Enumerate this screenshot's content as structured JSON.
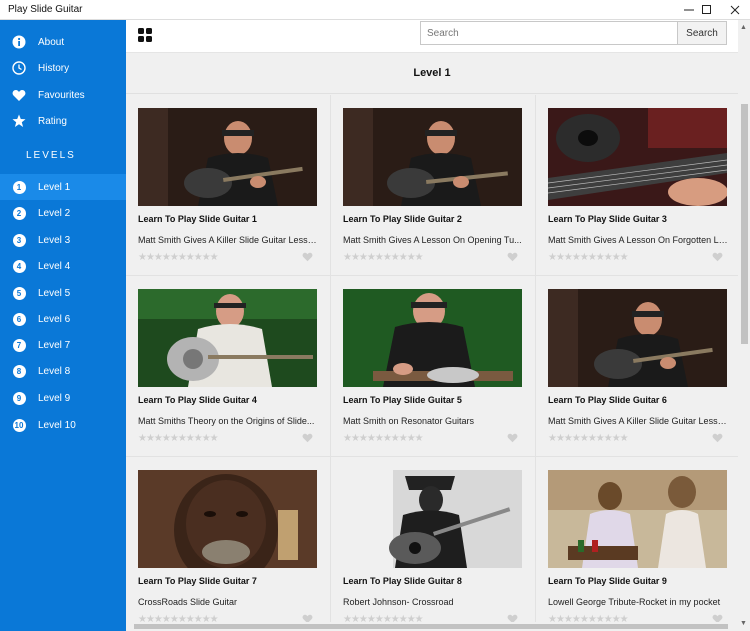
{
  "window": {
    "title": "Play Slide Guitar",
    "minimize_icon": "minimize-icon",
    "maximize_icon": "maximize-icon",
    "close_icon": "close-icon"
  },
  "sidebar": {
    "menu": [
      {
        "label": "About",
        "icon": "info-icon"
      },
      {
        "label": "History",
        "icon": "clock-icon"
      },
      {
        "label": "Favourites",
        "icon": "heart-icon"
      },
      {
        "label": "Rating",
        "icon": "star-icon"
      }
    ],
    "levels_heading": "LEVELS",
    "levels": [
      {
        "num": "1",
        "label": "Level 1"
      },
      {
        "num": "2",
        "label": "Level 2"
      },
      {
        "num": "3",
        "label": "Level 3"
      },
      {
        "num": "4",
        "label": "Level 4"
      },
      {
        "num": "5",
        "label": "Level 5"
      },
      {
        "num": "6",
        "label": "Level 6"
      },
      {
        "num": "7",
        "label": "Level 7"
      },
      {
        "num": "8",
        "label": "Level 8"
      },
      {
        "num": "9",
        "label": "Level 9"
      },
      {
        "num": "10",
        "label": "Level 10"
      }
    ],
    "selected_level": "Level 1"
  },
  "header": {
    "grid_icon": "grid-icon",
    "search_placeholder": "Search",
    "search_value": "",
    "search_button": "Search"
  },
  "main": {
    "level_title": "Level 1",
    "videos": [
      {
        "title": "Learn To Play Slide Guitar 1",
        "subtitle": "Matt Smith Gives A Killer Slide Guitar Lesso...",
        "rating": 0
      },
      {
        "title": "Learn To Play Slide Guitar 2",
        "subtitle": "Matt Smith Gives A Lesson On Opening Tu...",
        "rating": 0
      },
      {
        "title": "Learn To Play Slide Guitar 3",
        "subtitle": "Matt Smith Gives A Lesson On Forgotten Li...",
        "rating": 0
      },
      {
        "title": "Learn To Play Slide Guitar 4",
        "subtitle": "Matt Smiths Theory on the Origins of Slide...",
        "rating": 0
      },
      {
        "title": "Learn To Play Slide Guitar 5",
        "subtitle": "Matt Smith on Resonator Guitars",
        "rating": 0
      },
      {
        "title": "Learn To Play Slide Guitar 6",
        "subtitle": "Matt Smith Gives A Killer Slide Guitar Lesso...",
        "rating": 0
      },
      {
        "title": "Learn To Play Slide Guitar 7",
        "subtitle": "CrossRoads Slide Guitar",
        "rating": 0
      },
      {
        "title": "Learn To Play Slide Guitar 8",
        "subtitle": "Robert Johnson- Crossroad",
        "rating": 0
      },
      {
        "title": "Learn To Play Slide Guitar 9",
        "subtitle": "Lowell George Tribute-Rocket in my pocket",
        "rating": 0
      }
    ],
    "stars_glyphs": "★★★★★★★★★★",
    "max_rating": 10
  },
  "colors": {
    "sidebar_bg": "#0a78d7",
    "selected_bg": "#1a8ae8",
    "content_bg": "#f0f0f0",
    "star_inactive": "#cfcfcf"
  }
}
